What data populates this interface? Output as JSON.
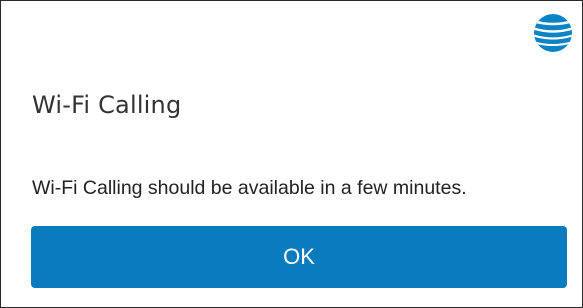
{
  "dialog": {
    "logo_icon": "globe-logo-icon",
    "title": "Wi-Fi Calling",
    "message": "Wi-Fi Calling should be available in a few minutes.",
    "ok_label": "OK"
  },
  "colors": {
    "button_blue": "#0a7bbd",
    "logo_blue": "#0a84c5",
    "border": "#2a2a2a"
  }
}
